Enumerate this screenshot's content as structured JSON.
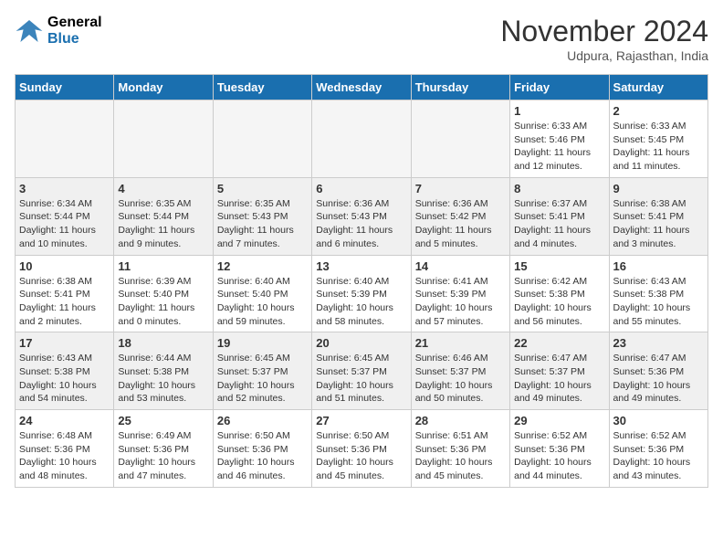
{
  "logo": {
    "line1": "General",
    "line2": "Blue"
  },
  "title": "November 2024",
  "location": "Udpura, Rajasthan, India",
  "weekdays": [
    "Sunday",
    "Monday",
    "Tuesday",
    "Wednesday",
    "Thursday",
    "Friday",
    "Saturday"
  ],
  "weeks": [
    [
      {
        "day": "",
        "info": ""
      },
      {
        "day": "",
        "info": ""
      },
      {
        "day": "",
        "info": ""
      },
      {
        "day": "",
        "info": ""
      },
      {
        "day": "",
        "info": ""
      },
      {
        "day": "1",
        "info": "Sunrise: 6:33 AM\nSunset: 5:46 PM\nDaylight: 11 hours and 12 minutes."
      },
      {
        "day": "2",
        "info": "Sunrise: 6:33 AM\nSunset: 5:45 PM\nDaylight: 11 hours and 11 minutes."
      }
    ],
    [
      {
        "day": "3",
        "info": "Sunrise: 6:34 AM\nSunset: 5:44 PM\nDaylight: 11 hours and 10 minutes."
      },
      {
        "day": "4",
        "info": "Sunrise: 6:35 AM\nSunset: 5:44 PM\nDaylight: 11 hours and 9 minutes."
      },
      {
        "day": "5",
        "info": "Sunrise: 6:35 AM\nSunset: 5:43 PM\nDaylight: 11 hours and 7 minutes."
      },
      {
        "day": "6",
        "info": "Sunrise: 6:36 AM\nSunset: 5:43 PM\nDaylight: 11 hours and 6 minutes."
      },
      {
        "day": "7",
        "info": "Sunrise: 6:36 AM\nSunset: 5:42 PM\nDaylight: 11 hours and 5 minutes."
      },
      {
        "day": "8",
        "info": "Sunrise: 6:37 AM\nSunset: 5:41 PM\nDaylight: 11 hours and 4 minutes."
      },
      {
        "day": "9",
        "info": "Sunrise: 6:38 AM\nSunset: 5:41 PM\nDaylight: 11 hours and 3 minutes."
      }
    ],
    [
      {
        "day": "10",
        "info": "Sunrise: 6:38 AM\nSunset: 5:41 PM\nDaylight: 11 hours and 2 minutes."
      },
      {
        "day": "11",
        "info": "Sunrise: 6:39 AM\nSunset: 5:40 PM\nDaylight: 11 hours and 0 minutes."
      },
      {
        "day": "12",
        "info": "Sunrise: 6:40 AM\nSunset: 5:40 PM\nDaylight: 10 hours and 59 minutes."
      },
      {
        "day": "13",
        "info": "Sunrise: 6:40 AM\nSunset: 5:39 PM\nDaylight: 10 hours and 58 minutes."
      },
      {
        "day": "14",
        "info": "Sunrise: 6:41 AM\nSunset: 5:39 PM\nDaylight: 10 hours and 57 minutes."
      },
      {
        "day": "15",
        "info": "Sunrise: 6:42 AM\nSunset: 5:38 PM\nDaylight: 10 hours and 56 minutes."
      },
      {
        "day": "16",
        "info": "Sunrise: 6:43 AM\nSunset: 5:38 PM\nDaylight: 10 hours and 55 minutes."
      }
    ],
    [
      {
        "day": "17",
        "info": "Sunrise: 6:43 AM\nSunset: 5:38 PM\nDaylight: 10 hours and 54 minutes."
      },
      {
        "day": "18",
        "info": "Sunrise: 6:44 AM\nSunset: 5:38 PM\nDaylight: 10 hours and 53 minutes."
      },
      {
        "day": "19",
        "info": "Sunrise: 6:45 AM\nSunset: 5:37 PM\nDaylight: 10 hours and 52 minutes."
      },
      {
        "day": "20",
        "info": "Sunrise: 6:45 AM\nSunset: 5:37 PM\nDaylight: 10 hours and 51 minutes."
      },
      {
        "day": "21",
        "info": "Sunrise: 6:46 AM\nSunset: 5:37 PM\nDaylight: 10 hours and 50 minutes."
      },
      {
        "day": "22",
        "info": "Sunrise: 6:47 AM\nSunset: 5:37 PM\nDaylight: 10 hours and 49 minutes."
      },
      {
        "day": "23",
        "info": "Sunrise: 6:47 AM\nSunset: 5:36 PM\nDaylight: 10 hours and 49 minutes."
      }
    ],
    [
      {
        "day": "24",
        "info": "Sunrise: 6:48 AM\nSunset: 5:36 PM\nDaylight: 10 hours and 48 minutes."
      },
      {
        "day": "25",
        "info": "Sunrise: 6:49 AM\nSunset: 5:36 PM\nDaylight: 10 hours and 47 minutes."
      },
      {
        "day": "26",
        "info": "Sunrise: 6:50 AM\nSunset: 5:36 PM\nDaylight: 10 hours and 46 minutes."
      },
      {
        "day": "27",
        "info": "Sunrise: 6:50 AM\nSunset: 5:36 PM\nDaylight: 10 hours and 45 minutes."
      },
      {
        "day": "28",
        "info": "Sunrise: 6:51 AM\nSunset: 5:36 PM\nDaylight: 10 hours and 45 minutes."
      },
      {
        "day": "29",
        "info": "Sunrise: 6:52 AM\nSunset: 5:36 PM\nDaylight: 10 hours and 44 minutes."
      },
      {
        "day": "30",
        "info": "Sunrise: 6:52 AM\nSunset: 5:36 PM\nDaylight: 10 hours and 43 minutes."
      }
    ]
  ]
}
